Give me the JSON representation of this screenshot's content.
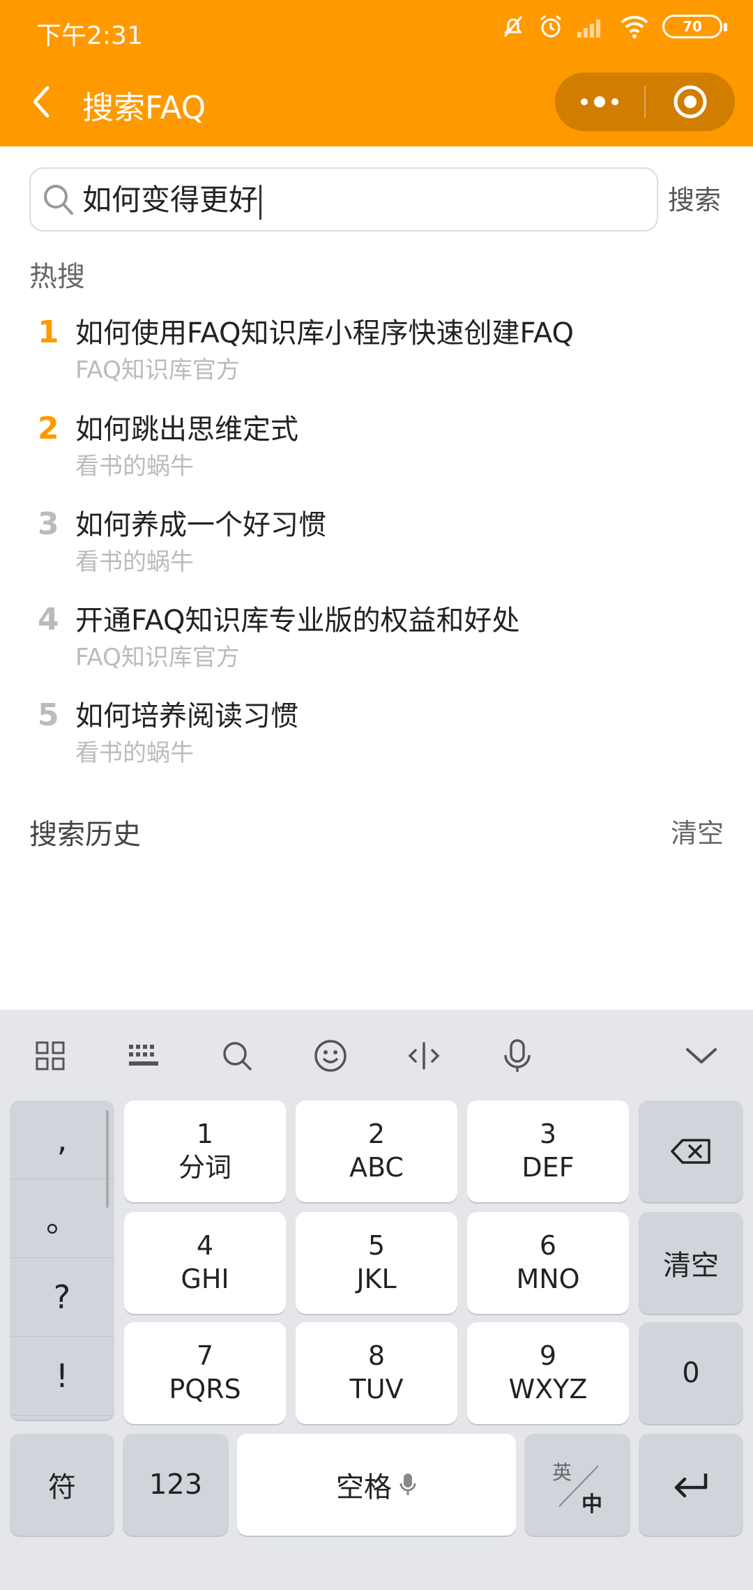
{
  "status_bar": {
    "time": "下午2:31",
    "battery": "70"
  },
  "nav": {
    "title": "搜索FAQ"
  },
  "search": {
    "value": "如何变得更好",
    "button": "搜索"
  },
  "hot": {
    "label": "热搜",
    "items": [
      {
        "rank": "1",
        "title": "如何使用FAQ知识库小程序快速创建FAQ",
        "author": "FAQ知识库官方"
      },
      {
        "rank": "2",
        "title": "如何跳出思维定式",
        "author": "看书的蜗牛"
      },
      {
        "rank": "3",
        "title": "如何养成一个好习惯",
        "author": "看书的蜗牛"
      },
      {
        "rank": "4",
        "title": "开通FAQ知识库专业版的权益和好处",
        "author": "FAQ知识库官方"
      },
      {
        "rank": "5",
        "title": "如何培养阅读习惯",
        "author": "看书的蜗牛"
      }
    ]
  },
  "history": {
    "label": "搜索历史",
    "clear": "清空"
  },
  "colors": {
    "accent": "#FF9900",
    "rank_top": "#FF9900",
    "rank_other": "#BBBBBB"
  },
  "keyboard": {
    "punct": [
      ",",
      "。",
      "?",
      "!"
    ],
    "keys": [
      {
        "num": "1",
        "letters": "分词"
      },
      {
        "num": "2",
        "letters": "ABC"
      },
      {
        "num": "3",
        "letters": "DEF"
      },
      {
        "num": "4",
        "letters": "GHI"
      },
      {
        "num": "5",
        "letters": "JKL"
      },
      {
        "num": "6",
        "letters": "MNO"
      },
      {
        "num": "7",
        "letters": "PQRS"
      },
      {
        "num": "8",
        "letters": "TUV"
      },
      {
        "num": "9",
        "letters": "WXYZ"
      }
    ],
    "clear": "清空",
    "zero": "0",
    "symbol": "符",
    "num_mode": "123",
    "space": "空格",
    "lang_en": "英",
    "lang_zh": "中"
  }
}
